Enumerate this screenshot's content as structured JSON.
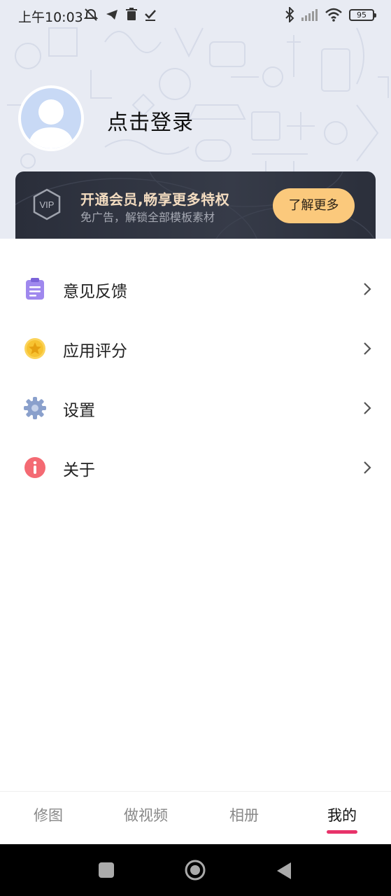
{
  "status_bar": {
    "time": "上午10:03",
    "battery": "95",
    "left_icons": [
      "muted-alarm-icon",
      "telegram-icon",
      "trash-icon",
      "check-icon"
    ],
    "right_icons": [
      "bluetooth-icon",
      "signal-icon",
      "wifi-icon",
      "battery-icon"
    ]
  },
  "profile": {
    "login_text": "点击登录"
  },
  "vip": {
    "badge": "VIP",
    "title": "开通会员,畅享更多特权",
    "subtitle": "免广告，解锁全部模板素材",
    "button": "了解更多"
  },
  "menu": {
    "items": [
      {
        "label": "意见反馈",
        "icon": "feedback-icon"
      },
      {
        "label": "应用评分",
        "icon": "star-icon"
      },
      {
        "label": "设置",
        "icon": "gear-icon"
      },
      {
        "label": "关于",
        "icon": "info-icon"
      }
    ]
  },
  "tabs": {
    "items": [
      {
        "label": "修图"
      },
      {
        "label": "做视频"
      },
      {
        "label": "相册"
      },
      {
        "label": "我的"
      }
    ],
    "active": "我的"
  },
  "colors": {
    "accent": "#e8336a",
    "vip_button": "#fbc97c",
    "vip_title": "#f3dcc0",
    "header_bg": "#e8ebf3"
  }
}
